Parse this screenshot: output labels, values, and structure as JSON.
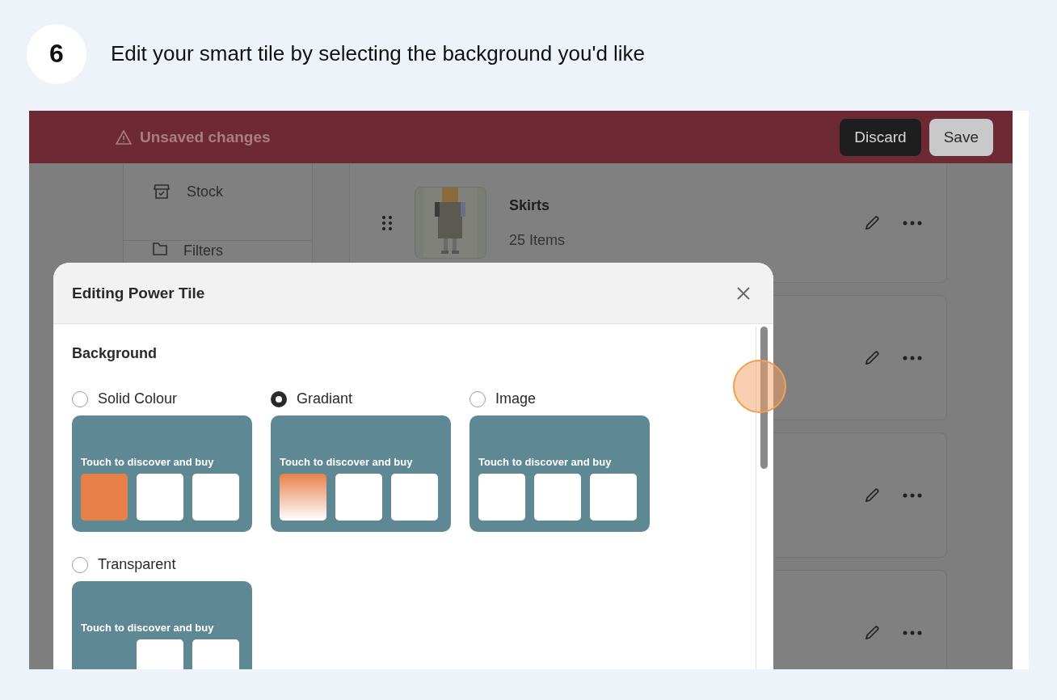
{
  "step": {
    "number": "6",
    "text": "Edit your smart tile by selecting the background you'd like"
  },
  "top_bar": {
    "message": "Unsaved changes",
    "buttons": [
      {
        "label": "Discard",
        "kind": "dark"
      },
      {
        "label": "Save",
        "kind": "light"
      }
    ]
  },
  "sidebar": {
    "items": [
      {
        "label": "Stock",
        "kind": "stock"
      },
      {
        "label": "Filters",
        "kind": "filters"
      }
    ]
  },
  "collections": [
    {
      "name": "Skirts",
      "count": "25 Items",
      "kind": "picture"
    },
    {
      "kind": "hidden"
    },
    {
      "kind": "hidden"
    },
    {
      "kind": "hidden"
    }
  ],
  "modal": {
    "title": "Editing Power Tile",
    "section": "Background",
    "options": [
      {
        "label": "Solid Colour",
        "selected": false,
        "kind": "solid",
        "preview_text": "Touch to discover and buy"
      },
      {
        "label": "Gradiant",
        "selected": true,
        "kind": "gradient",
        "preview_text": "Touch to discover and buy"
      },
      {
        "label": "Image",
        "selected": false,
        "preview_text": "Touch to discover and buy"
      },
      {
        "label": "Transparent",
        "selected": false,
        "kind": "transparent",
        "preview_text": "Touch to discover and buy"
      }
    ]
  }
}
